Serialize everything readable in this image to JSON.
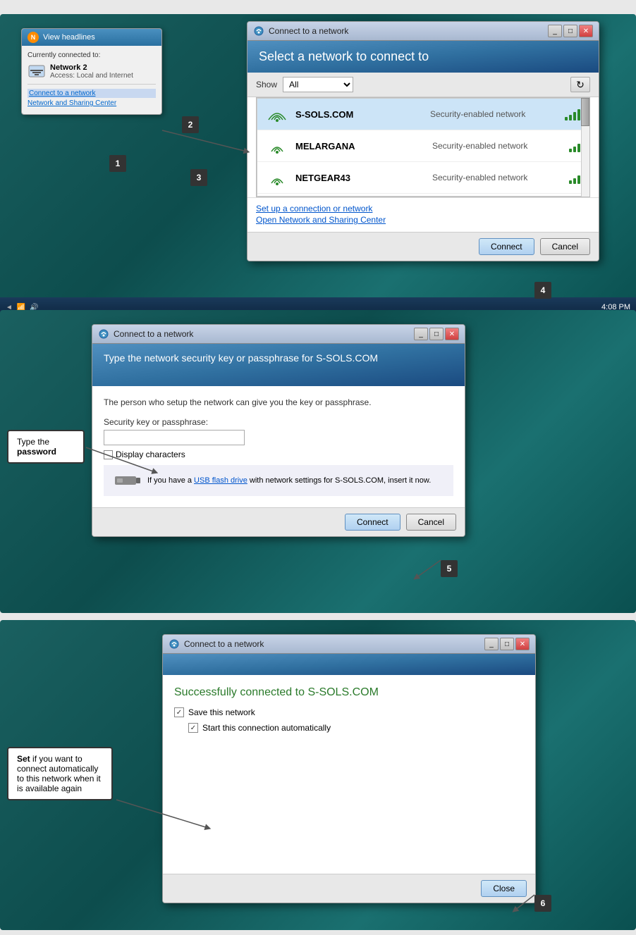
{
  "section1": {
    "taskbar_popup": {
      "header_label": "View headlines",
      "connected_to": "Currently connected to:",
      "network_name": "Network 2",
      "network_access": "Access:  Local and Internet",
      "link_connect": "Connect to a network",
      "link_sharing": "Network and Sharing Center",
      "time": "4:08 PM"
    },
    "dialog": {
      "title": "Connect to a network",
      "header_title": "Select a network to connect to",
      "show_label": "Show",
      "show_value": "All",
      "networks": [
        {
          "name": "S-SOLS.COM",
          "type": "Security-enabled network",
          "signal": 4,
          "selected": true
        },
        {
          "name": "MELARGANA",
          "type": "Security-enabled network",
          "signal": 3,
          "selected": false
        },
        {
          "name": "NETGEAR43",
          "type": "Security-enabled network",
          "signal": 3,
          "selected": false
        }
      ],
      "footer_links": [
        "Set up a connection or network",
        "Open Network and Sharing Center"
      ],
      "btn_connect": "Connect",
      "btn_cancel": "Cancel"
    },
    "step1": "1",
    "step2": "2",
    "step3": "3",
    "step4": "4"
  },
  "section2": {
    "dialog": {
      "title": "Connect to a network",
      "header_title": "Type the network security key or passphrase for S-SOLS.COM",
      "subtitle": "The person who setup the network can give you the key or passphrase.",
      "security_key_label": "Security key or passphrase:",
      "display_chars_label": "Display characters",
      "usb_text": "If you have a ",
      "usb_link": "USB flash drive",
      "usb_text2": " with network settings for S-SOLS.COM, insert it now.",
      "btn_connect": "Connect",
      "btn_cancel": "Cancel"
    },
    "callout": {
      "line1": "Type the",
      "line2": "password"
    },
    "step5": "5"
  },
  "section3": {
    "dialog": {
      "title": "Connect to a network",
      "success_message": "Successfully connected to S-SOLS.COM",
      "save_network_label": "Save this network",
      "auto_connect_label": "Start this connection automatically",
      "btn_close": "Close"
    },
    "callout": {
      "text": "Set if you want to connect automatically to this network when it is available again"
    },
    "step6": "6"
  }
}
